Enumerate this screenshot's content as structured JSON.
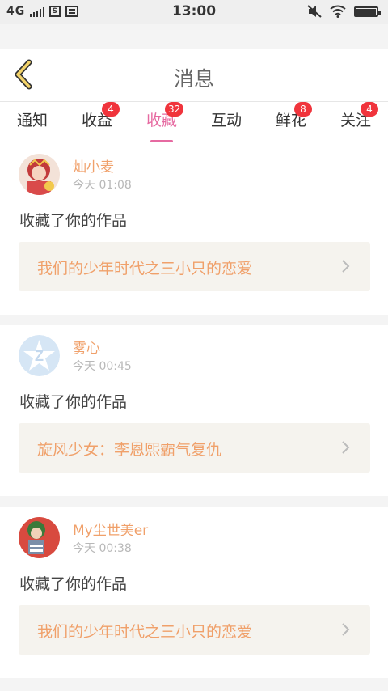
{
  "status_bar": {
    "network": "4G",
    "time": "13:00",
    "clip_icon": "S"
  },
  "header": {
    "title": "消息",
    "back_icon": "chevron-left-icon"
  },
  "tabs": [
    {
      "label": "通知",
      "badge": ""
    },
    {
      "label": "收益",
      "badge": "4"
    },
    {
      "label": "收藏",
      "badge": "32",
      "active": true
    },
    {
      "label": "互动",
      "badge": ""
    },
    {
      "label": "鲜花",
      "badge": "8"
    },
    {
      "label": "关注",
      "badge": "4"
    }
  ],
  "colors": {
    "accent": "#e66aa1",
    "name": "#f0a06a",
    "badge": "#f0343c"
  },
  "notifications": [
    {
      "user": "灿小麦",
      "time": "今天 01:08",
      "action": "收藏了你的作品",
      "work": "我们的少年时代之三小只的恋爱",
      "avatar": "anime-girl-avatar"
    },
    {
      "user": "雾心",
      "time": "今天 00:45",
      "action": "收藏了你的作品",
      "work": "旋风少女：李恩熙霸气复仇",
      "avatar": "default-z-avatar"
    },
    {
      "user": "My尘世美er",
      "time": "今天 00:38",
      "action": "收藏了你的作品",
      "work": "我们的少年时代之三小只的恋爱",
      "avatar": "cartoon-person-avatar"
    }
  ]
}
